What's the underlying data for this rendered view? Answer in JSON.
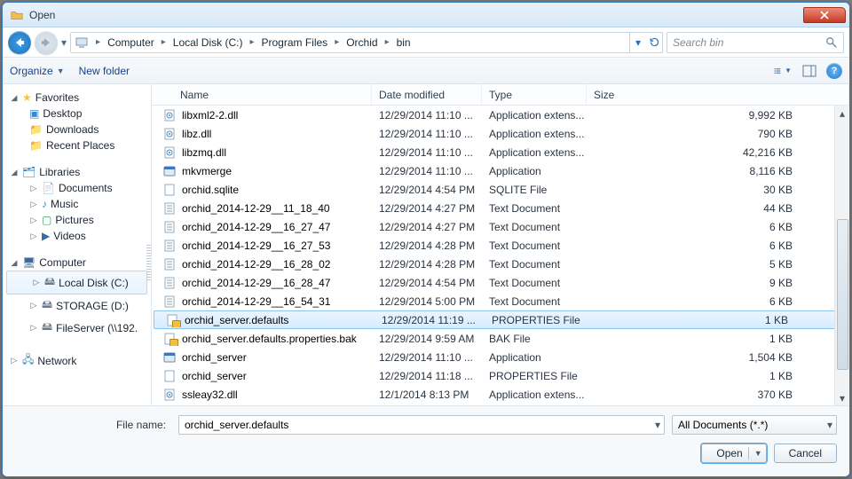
{
  "title": "Open",
  "breadcrumb": [
    "Computer",
    "Local Disk (C:)",
    "Program Files",
    "Orchid",
    "bin"
  ],
  "search_placeholder": "Search bin",
  "toolbar": {
    "organize": "Organize",
    "newfolder": "New folder"
  },
  "tree": {
    "favorites": {
      "label": "Favorites",
      "items": [
        "Desktop",
        "Downloads",
        "Recent Places"
      ]
    },
    "libraries": {
      "label": "Libraries",
      "items": [
        "Documents",
        "Music",
        "Pictures",
        "Videos"
      ]
    },
    "computer": {
      "label": "Computer",
      "items": [
        "Local Disk (C:)",
        "STORAGE (D:)",
        "FileServer (\\\\192."
      ]
    },
    "network": {
      "label": "Network"
    }
  },
  "columns": {
    "name": "Name",
    "date": "Date modified",
    "type": "Type",
    "size": "Size"
  },
  "files": [
    {
      "ico": "dll",
      "name": "libxml2-2.dll",
      "date": "12/29/2014 11:10 ...",
      "type": "Application extens...",
      "size": "9,992 KB"
    },
    {
      "ico": "dll",
      "name": "libz.dll",
      "date": "12/29/2014 11:10 ...",
      "type": "Application extens...",
      "size": "790 KB"
    },
    {
      "ico": "dll",
      "name": "libzmq.dll",
      "date": "12/29/2014 11:10 ...",
      "type": "Application extens...",
      "size": "42,216 KB"
    },
    {
      "ico": "exe",
      "name": "mkvmerge",
      "date": "12/29/2014 11:10 ...",
      "type": "Application",
      "size": "8,116 KB"
    },
    {
      "ico": "file",
      "name": "orchid.sqlite",
      "date": "12/29/2014 4:54 PM",
      "type": "SQLITE File",
      "size": "30 KB"
    },
    {
      "ico": "txt",
      "name": "orchid_2014-12-29__11_18_40",
      "date": "12/29/2014 4:27 PM",
      "type": "Text Document",
      "size": "44 KB"
    },
    {
      "ico": "txt",
      "name": "orchid_2014-12-29__16_27_47",
      "date": "12/29/2014 4:27 PM",
      "type": "Text Document",
      "size": "6 KB"
    },
    {
      "ico": "txt",
      "name": "orchid_2014-12-29__16_27_53",
      "date": "12/29/2014 4:28 PM",
      "type": "Text Document",
      "size": "6 KB"
    },
    {
      "ico": "txt",
      "name": "orchid_2014-12-29__16_28_02",
      "date": "12/29/2014 4:28 PM",
      "type": "Text Document",
      "size": "5 KB"
    },
    {
      "ico": "txt",
      "name": "orchid_2014-12-29__16_28_47",
      "date": "12/29/2014 4:54 PM",
      "type": "Text Document",
      "size": "9 KB"
    },
    {
      "ico": "txt",
      "name": "orchid_2014-12-29__16_54_31",
      "date": "12/29/2014 5:00 PM",
      "type": "Text Document",
      "size": "6 KB"
    },
    {
      "ico": "lock",
      "name": "orchid_server.defaults",
      "date": "12/29/2014 11:19 ...",
      "type": "PROPERTIES File",
      "size": "1 KB",
      "selected": true
    },
    {
      "ico": "lock",
      "name": "orchid_server.defaults.properties.bak",
      "date": "12/29/2014 9:59 AM",
      "type": "BAK File",
      "size": "1 KB"
    },
    {
      "ico": "exe",
      "name": "orchid_server",
      "date": "12/29/2014 11:10 ...",
      "type": "Application",
      "size": "1,504 KB"
    },
    {
      "ico": "file",
      "name": "orchid_server",
      "date": "12/29/2014 11:18 ...",
      "type": "PROPERTIES File",
      "size": "1 KB"
    },
    {
      "ico": "dll",
      "name": "ssleay32.dll",
      "date": "12/1/2014 8:13 PM",
      "type": "Application extens...",
      "size": "370 KB"
    }
  ],
  "filename": {
    "label": "File name:",
    "value": "orchid_server.defaults"
  },
  "filter": "All Documents (*.*)",
  "buttons": {
    "open": "Open",
    "cancel": "Cancel"
  }
}
